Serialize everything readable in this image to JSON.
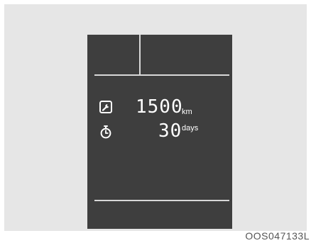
{
  "display": {
    "service_distance": {
      "icon": "wrench-icon",
      "value": "1500",
      "unit": "km"
    },
    "service_time": {
      "icon": "stopwatch-icon",
      "value": "30",
      "unit": "days"
    }
  },
  "caption": "OOS047133L",
  "colors": {
    "background": "#e6e6e6",
    "display": "#3e3e3e",
    "text": "#ffffff"
  }
}
